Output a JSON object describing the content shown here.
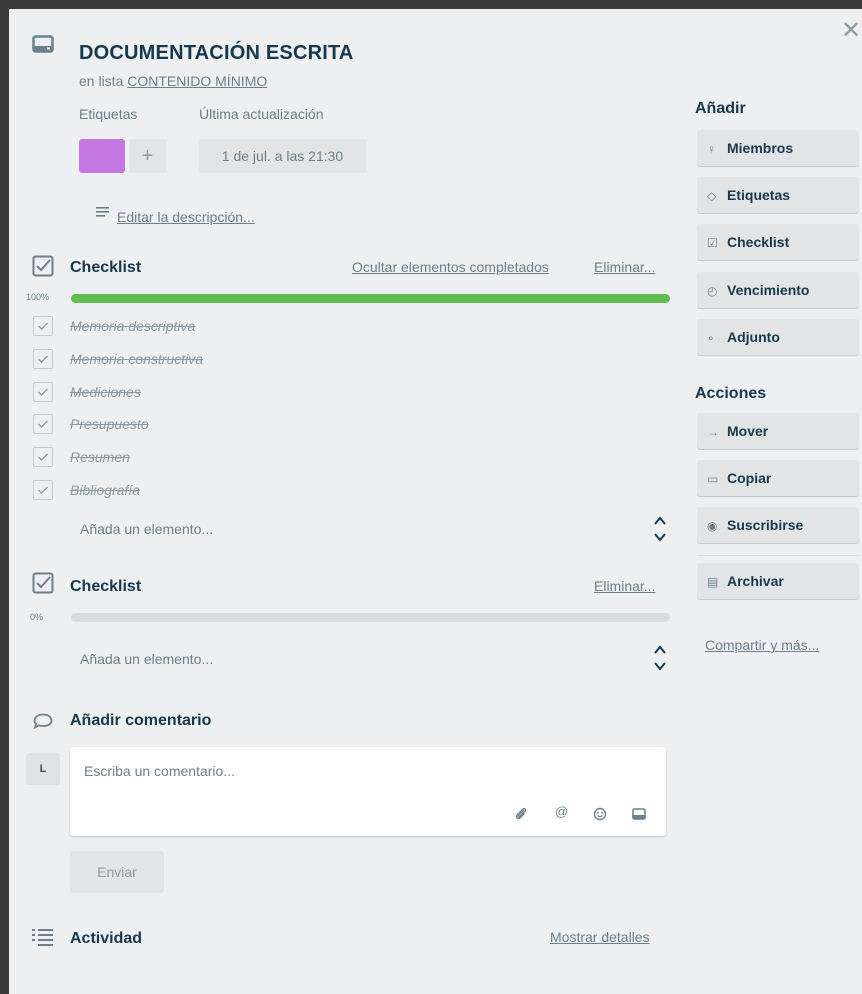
{
  "card": {
    "title": "DOCUMENTACIÓN ESCRITA",
    "in_list_prefix": "en lista",
    "list_name": "CONTENIDO MÍNIMO",
    "close_icon": "close-icon"
  },
  "meta": {
    "labels_heading": "Etiquetas",
    "updated_heading": "Última actualización",
    "label_color": "#c377e0",
    "add_label": "+",
    "updated_value": "1 de jul. a las 21:30"
  },
  "description": {
    "edit_link": "Editar la descripción..."
  },
  "checklists": [
    {
      "title": "Checklist",
      "hide_completed": "Ocultar elementos completados",
      "delete": "Eliminar...",
      "progress_label": "100%",
      "progress": 1.0,
      "items": [
        {
          "text": "Memoria descriptiva",
          "done": true
        },
        {
          "text": "Memoria constructiva",
          "done": true
        },
        {
          "text": "Mediciones",
          "done": true
        },
        {
          "text": "Presupuesto",
          "done": true
        },
        {
          "text": "Resumen",
          "done": true
        },
        {
          "text": "Bibliografía",
          "done": true
        }
      ],
      "add_item": "Añada un elemento..."
    },
    {
      "title": "Checklist",
      "delete": "Eliminar...",
      "progress_label": "0%",
      "progress": 0.0,
      "items": [],
      "add_item": "Añada un elemento..."
    }
  ],
  "comment": {
    "heading": "Añadir comentario",
    "avatar_initial": "L",
    "placeholder": "Escriba un comentario...",
    "send": "Enviar"
  },
  "activity": {
    "heading": "Actividad",
    "show_details": "Mostrar detalles"
  },
  "sidebar": {
    "add_heading": "Añadir",
    "add_buttons": [
      {
        "label": "Miembros",
        "icon": "person-icon"
      },
      {
        "label": "Etiquetas",
        "icon": "tag-icon"
      },
      {
        "label": "Checklist",
        "icon": "checklist-icon"
      },
      {
        "label": "Vencimiento",
        "icon": "clock-icon"
      },
      {
        "label": "Adjunto",
        "icon": "paperclip-icon"
      }
    ],
    "actions_heading": "Acciones",
    "action_buttons": [
      {
        "label": "Mover",
        "icon": "arrow-right-icon"
      },
      {
        "label": "Copiar",
        "icon": "card-icon"
      },
      {
        "label": "Suscribirse",
        "icon": "eye-icon"
      },
      {
        "label": "Archivar",
        "icon": "archive-icon"
      }
    ],
    "share_link": "Compartir y más..."
  },
  "colors": {
    "progress_complete": "#61bd4f",
    "panel_bg": "#edeff0",
    "button_bg": "#e2e4e6"
  }
}
